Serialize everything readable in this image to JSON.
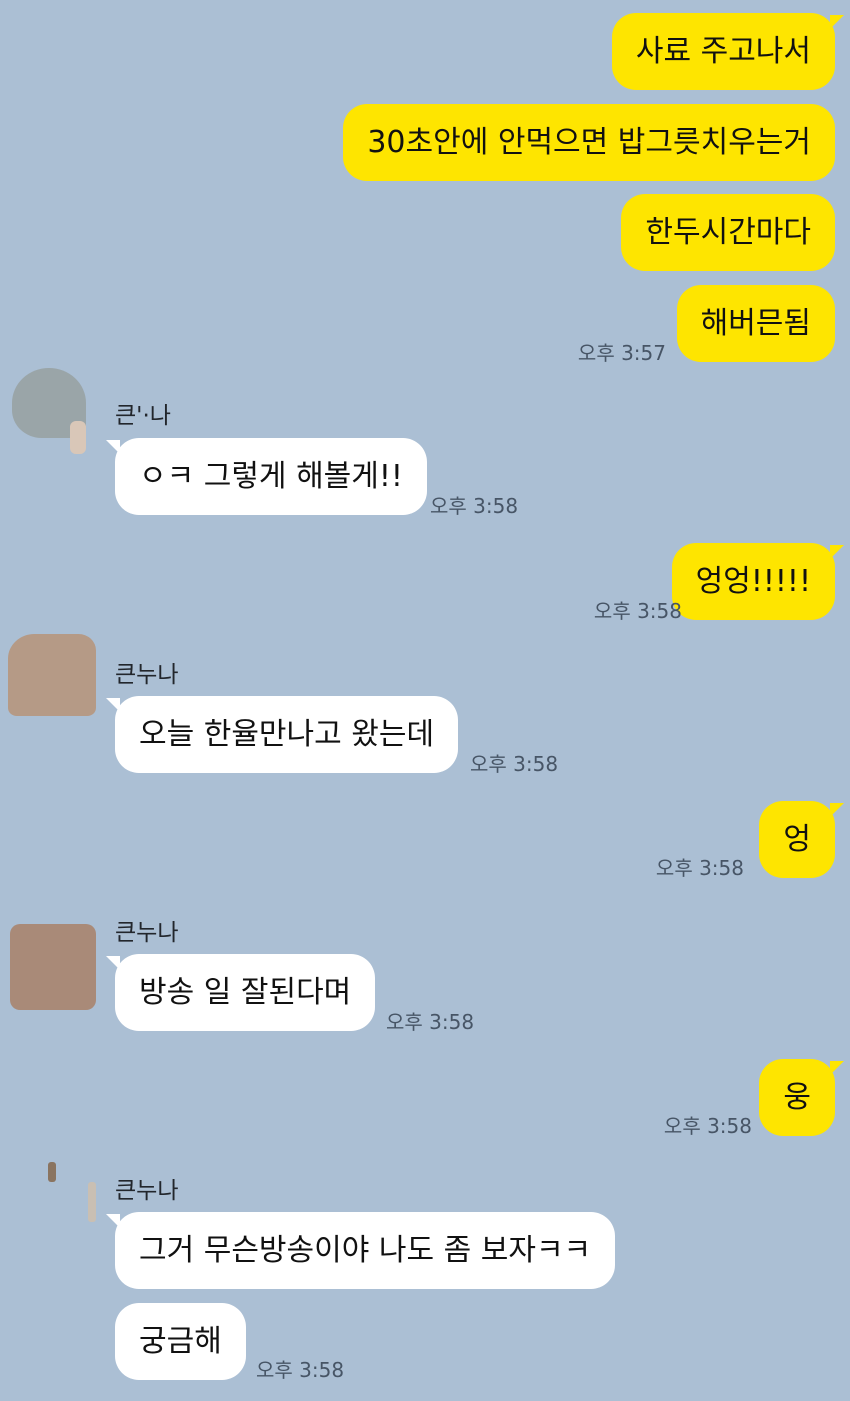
{
  "colors": {
    "background": "#abbfd4",
    "my_bubble": "#fee500",
    "their_bubble": "#ffffff",
    "time_text": "#475566"
  },
  "messages": [
    {
      "text": "사료 주고나서"
    },
    {
      "text": "30초안에 안먹으면 밥그릇치우는거"
    },
    {
      "text": "한두시간마다"
    },
    {
      "text": "해버믄됨",
      "time": "오후 3:57"
    },
    {
      "sender": "큰'·나",
      "text": "ㅇㅋ 그렇게 해볼게!!",
      "time": "오후 3:58"
    },
    {
      "text": "엉엉!!!!!",
      "time": "오후 3:58"
    },
    {
      "sender": "큰누나",
      "text": "오늘 한율만나고 왔는데",
      "time": "오후 3:58"
    },
    {
      "text": "엉",
      "time": "오후 3:58"
    },
    {
      "sender": "큰누나",
      "text": "방송 일 잘된다며",
      "time": "오후 3:58"
    },
    {
      "text": "웅",
      "time": "오후 3:58"
    },
    {
      "sender": "큰누나",
      "text": "그거 무슨방송이야 나도 좀 보자ㅋㅋ"
    },
    {
      "text": "궁금해",
      "time": "오후 3:58"
    }
  ]
}
